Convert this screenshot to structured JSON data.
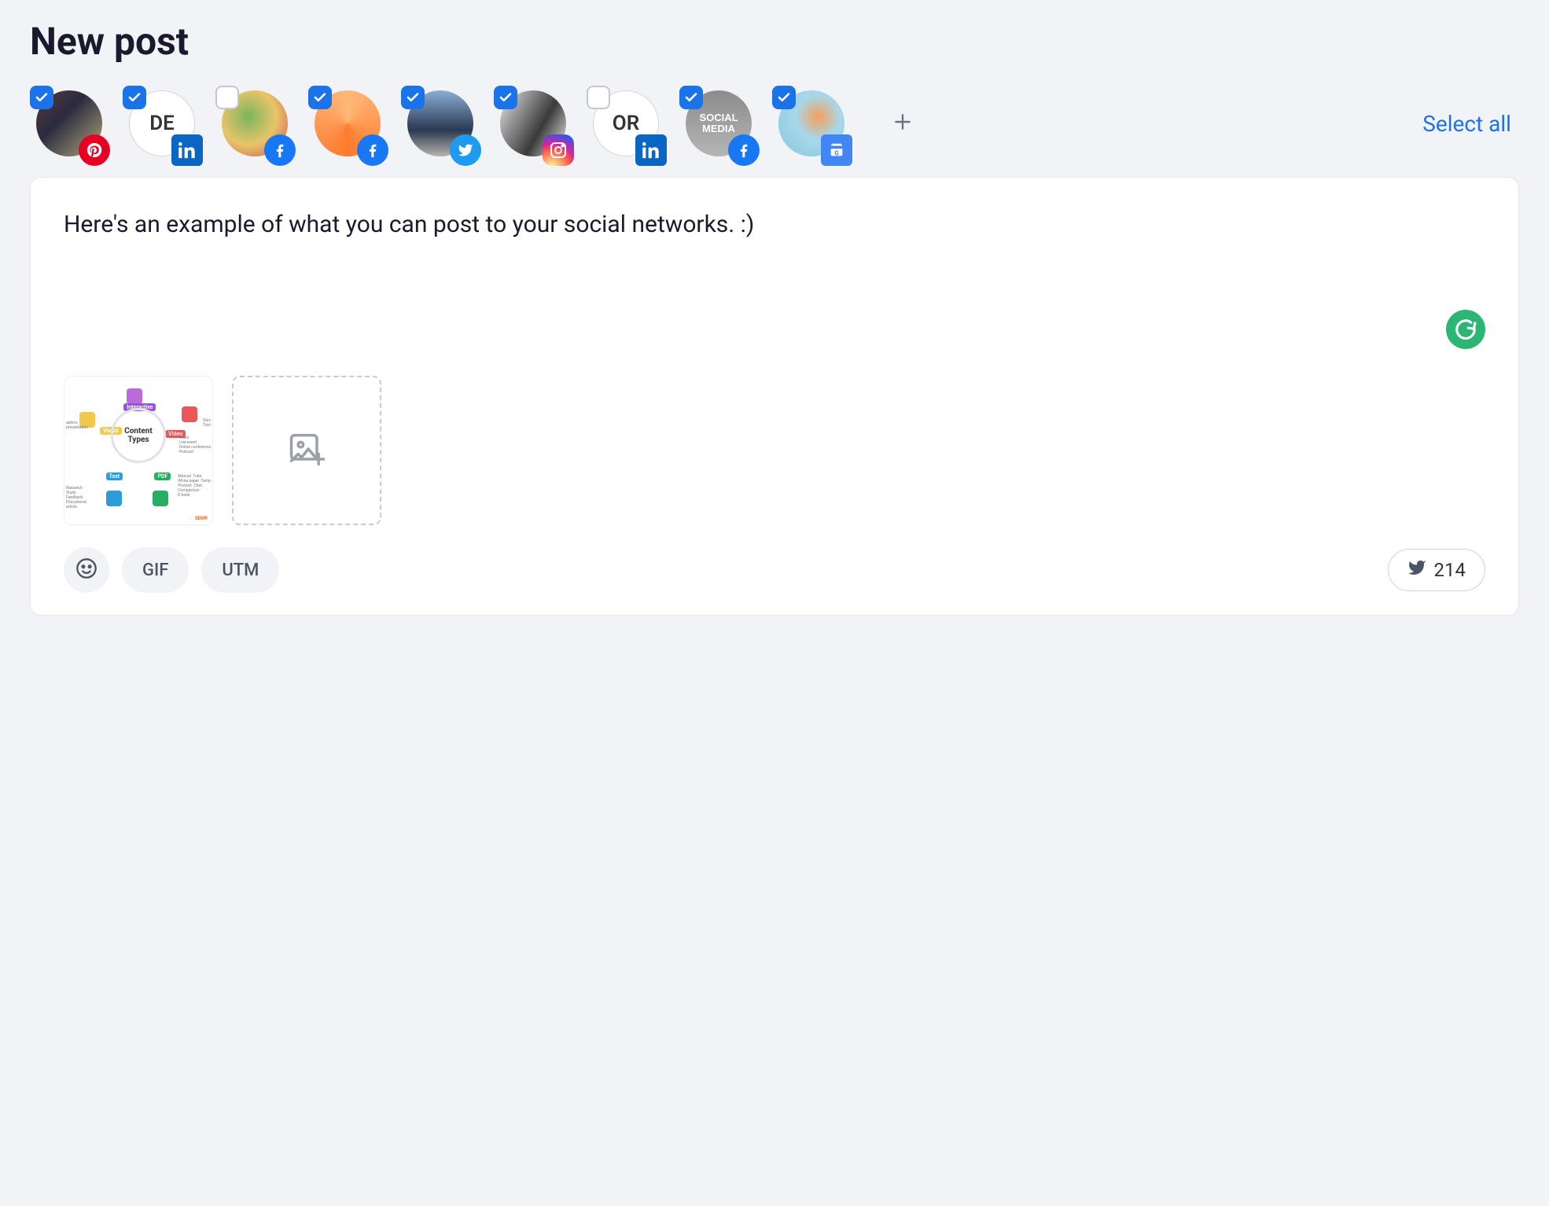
{
  "title": "New post",
  "select_all_label": "Select all",
  "accounts": [
    {
      "initials": "",
      "avatarClass": "av-1",
      "borderOnly": false,
      "checked": true,
      "network": "pinterest"
    },
    {
      "initials": "DE",
      "avatarClass": "",
      "borderOnly": true,
      "checked": true,
      "network": "linkedin"
    },
    {
      "initials": "",
      "avatarClass": "av-3",
      "borderOnly": false,
      "checked": false,
      "network": "facebook"
    },
    {
      "initials": "",
      "avatarClass": "av-4",
      "borderOnly": false,
      "checked": true,
      "network": "facebook"
    },
    {
      "initials": "",
      "avatarClass": "av-5",
      "borderOnly": false,
      "checked": true,
      "network": "twitter"
    },
    {
      "initials": "",
      "avatarClass": "av-6",
      "borderOnly": false,
      "checked": true,
      "network": "instagram"
    },
    {
      "initials": "OR",
      "avatarClass": "",
      "borderOnly": true,
      "checked": false,
      "network": "linkedin"
    },
    {
      "initials": "",
      "avatarClass": "av-8",
      "borderOnly": false,
      "checked": true,
      "network": "facebook"
    },
    {
      "initials": "",
      "avatarClass": "av-9",
      "borderOnly": false,
      "checked": true,
      "network": "google"
    }
  ],
  "composer": {
    "text": "Here's an example of what you can post to your social networks. :)"
  },
  "attachment_preview": {
    "center_label_line1": "Content",
    "center_label_line2": "Types",
    "tags": {
      "interactive": "Interactive",
      "visual": "Visual",
      "video": "Video",
      "text": "Text",
      "pdf": "PDF"
    },
    "side_labels": {
      "tl": "aphics\npresentation",
      "tr": "Quiz\nTool",
      "mr": "Video\nLive event\nOnline conference\nPodcast",
      "bl": "Research\nStudy\nFeedback\nEducational\narticle",
      "br": "Manual  Tutor\nWhite paper  Temp\nProduct  Chec\nComparison\nE-book"
    },
    "brand": "SEMR"
  },
  "tools": {
    "gif_label": "GIF",
    "utm_label": "UTM"
  },
  "char_counter": {
    "count": "214"
  }
}
